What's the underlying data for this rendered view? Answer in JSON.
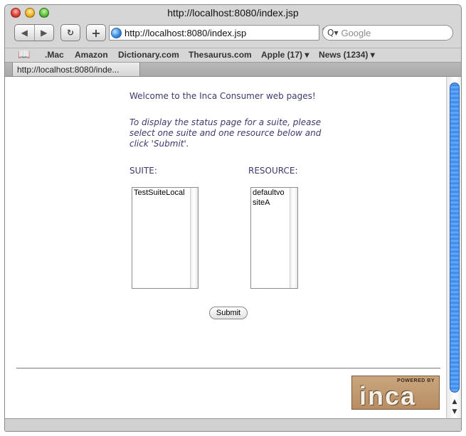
{
  "window": {
    "title": "http://localhost:8080/index.jsp"
  },
  "toolbar": {
    "back_glyph": "◀",
    "forward_glyph": "▶",
    "reload_glyph": "↻",
    "add_glyph": "+",
    "url": "http://localhost:8080/index.jsp",
    "search_placeholder": "Google",
    "search_icon": "Q▾"
  },
  "bookmarks": {
    "book_icon": "📖",
    "items": [
      ".Mac",
      "Amazon",
      "Dictionary.com",
      "Thesaurus.com",
      "Apple (17) ▾",
      "News (1234) ▾"
    ]
  },
  "tab": {
    "label": "http://localhost:8080/inde..."
  },
  "page": {
    "welcome": "Welcome to the Inca Consumer web pages!",
    "intro": "To display the status page for a suite, please select one suite and one resource below and click 'Submit'.",
    "suite_label": "SUITE:",
    "resource_label": "RESOURCE:",
    "suites": [
      "TestSuiteLocal"
    ],
    "resources": [
      "defaultvo",
      "siteA"
    ],
    "submit": "Submit"
  },
  "logo": {
    "top": "POWERED BY",
    "main": "inca"
  },
  "scrollbar": {
    "up": "▲",
    "down": "▼"
  }
}
